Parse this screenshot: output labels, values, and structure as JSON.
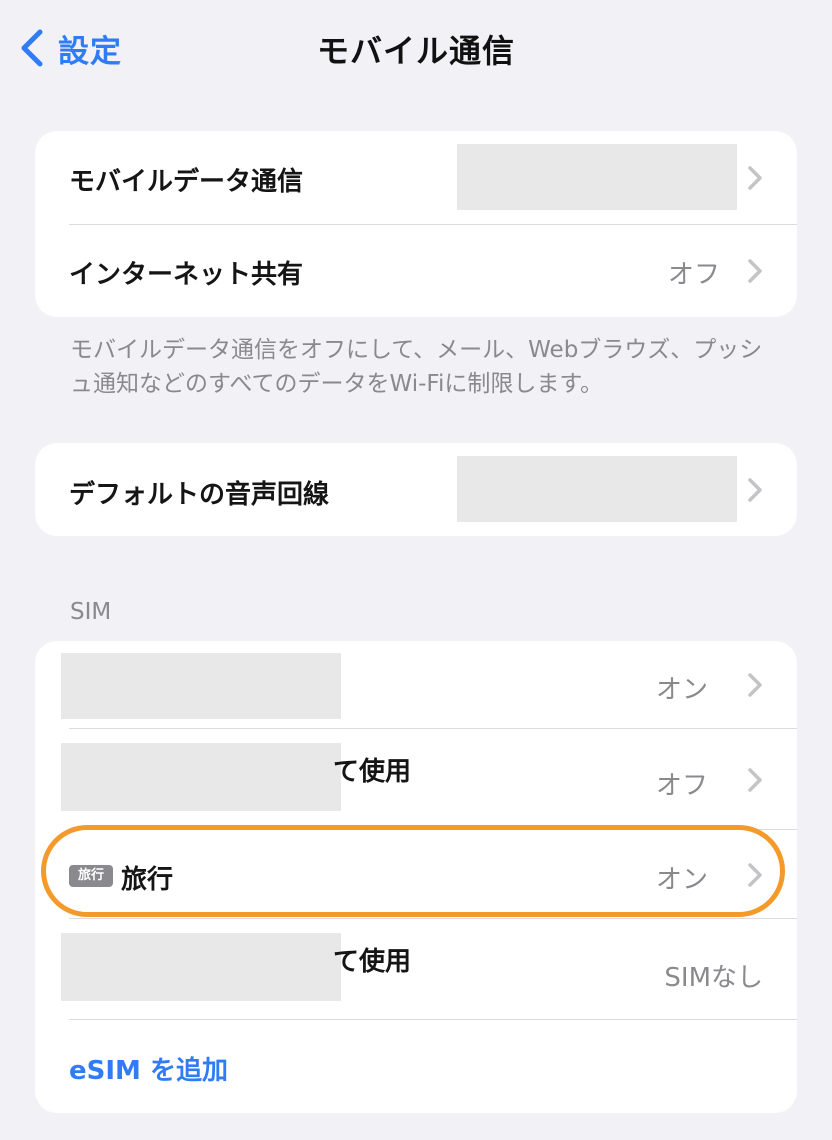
{
  "nav": {
    "back_label": "設定",
    "title": "モバイル通信"
  },
  "group1": {
    "rows": [
      {
        "label": "モバイルデータ通信",
        "value": ""
      },
      {
        "label": "インターネット共有",
        "value": "オフ"
      }
    ],
    "footer": "モバイルデータ通信をオフにして、メール、Webブラウズ、プッシュ通知などのすべてのデータをWi-Fiに制限します。"
  },
  "group2": {
    "rows": [
      {
        "label": "デフォルトの音声回線",
        "value": ""
      }
    ]
  },
  "sim_section": {
    "header": "SIM",
    "rows": [
      {
        "label": "",
        "value": "オン"
      },
      {
        "label_suffix": "て使用",
        "value": "オフ"
      },
      {
        "tag": "旅行",
        "label": "旅行",
        "value": "オン"
      },
      {
        "label_suffix": "て使用",
        "value": "SIMなし"
      }
    ],
    "add_esim": "eSIM を追加"
  },
  "colors": {
    "accent": "#2f7cf6",
    "highlight": "#f39a2a",
    "secondary_text": "#8a8a8e"
  }
}
